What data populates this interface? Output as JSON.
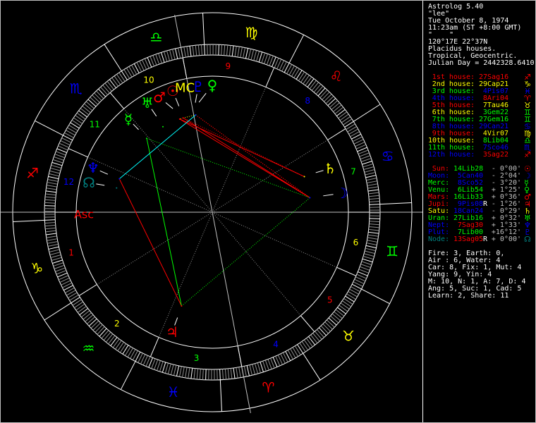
{
  "header": {
    "app_title": "Astrolog 5.40",
    "chart_name": "\"lee\"",
    "date": "Tue October 8, 1974",
    "time": "11:23am (ST +8:00 GMT)",
    "location_name": "\"    \"",
    "coordinates": "120°17E 22°37N",
    "house_system": "Placidus houses.",
    "zodiac": "Tropical, Geocentric.",
    "julian_day": "Julian Day = 2442328.6410"
  },
  "colors": {
    "red": "#ff0000",
    "yellow": "#ffff00",
    "green": "#00ff00",
    "blue": "#0000ff",
    "teal": "#008080",
    "gray": "#c0c0c0",
    "white": "#ffffff"
  },
  "houses": [
    {
      "label": "1st house:",
      "value": "27Sag16",
      "glyph": "♐",
      "label_color": "#ff0000",
      "value_color": "#ff0000",
      "lon": 267.27
    },
    {
      "label": "2nd house:",
      "value": "29Cap21",
      "glyph": "♑",
      "label_color": "#ffff00",
      "value_color": "#ffff00",
      "lon": 299.35
    },
    {
      "label": "3rd house:",
      "value": "4Pis07",
      "glyph": "♓",
      "label_color": "#00ff00",
      "value_color": "#0000ff",
      "lon": 334.12
    },
    {
      "label": "4th house:",
      "value": "8Ari04",
      "glyph": "♈",
      "label_color": "#0000ff",
      "value_color": "#ff0000",
      "lon": 8.07
    },
    {
      "label": "5th house:",
      "value": "7Tau46",
      "glyph": "♉",
      "label_color": "#ff0000",
      "value_color": "#ffff00",
      "lon": 37.77
    },
    {
      "label": "6th house:",
      "value": "3Gem22",
      "glyph": "♊",
      "label_color": "#ffff00",
      "value_color": "#00ff00",
      "lon": 63.37
    },
    {
      "label": "7th house:",
      "value": "27Gem16",
      "glyph": "♊",
      "label_color": "#00ff00",
      "value_color": "#00ff00",
      "lon": 87.27
    },
    {
      "label": "8th house:",
      "value": "29Can21",
      "glyph": "♋",
      "label_color": "#0000ff",
      "value_color": "#0000ff",
      "lon": 119.35
    },
    {
      "label": "9th house:",
      "value": "4Vir07",
      "glyph": "♍",
      "label_color": "#ff0000",
      "value_color": "#ffff00",
      "lon": 154.12
    },
    {
      "label": "10th house:",
      "value": "8Lib04",
      "glyph": "♎",
      "label_color": "#ffff00",
      "value_color": "#00ff00",
      "lon": 188.07
    },
    {
      "label": "11th house:",
      "value": "7Sco46",
      "glyph": "♏",
      "label_color": "#00ff00",
      "value_color": "#0000ff",
      "lon": 217.77
    },
    {
      "label": "12th house:",
      "value": "3Sag22",
      "glyph": "♐",
      "label_color": "#0000ff",
      "value_color": "#ff0000",
      "lon": 243.37
    }
  ],
  "planets": [
    {
      "key": "sun",
      "label": "Sun:",
      "value": "14Lib28",
      "retro": "",
      "lat": "- 0°00'",
      "glyph": "☉",
      "color": "#ff0000",
      "value_color": "#00ff00",
      "lon": 194.47
    },
    {
      "key": "moon",
      "label": "Moon:",
      "value": "5Can40",
      "retro": "",
      "lat": "- 2°04'",
      "glyph": "☽",
      "color": "#0000ff",
      "value_color": "#0000ff",
      "lon": 95.67
    },
    {
      "key": "merc",
      "label": "Merc:",
      "value": "8Sco52",
      "retro": "",
      "lat": "- 3°20'",
      "glyph": "☿",
      "color": "#00ff00",
      "value_color": "#0000ff",
      "lon": 218.87
    },
    {
      "key": "venu",
      "label": "Venu:",
      "value": "6Lib54",
      "retro": "",
      "lat": "+ 1°25'",
      "glyph": "♀",
      "color": "#00ff00",
      "value_color": "#00ff00",
      "lon": 186.9
    },
    {
      "key": "mars",
      "label": "Mars:",
      "value": "16Lib33",
      "retro": "",
      "lat": "+ 0°36'",
      "glyph": "♂",
      "color": "#ff0000",
      "value_color": "#00ff00",
      "lon": 196.55
    },
    {
      "key": "jupi",
      "label": "Jupi:",
      "value": "9Pis08",
      "retro": "R",
      "lat": "- 1°26'",
      "glyph": "♃",
      "color": "#ff0000",
      "value_color": "#0000ff",
      "lon": 339.13
    },
    {
      "key": "satu",
      "label": "Satu:",
      "value": "18Can24",
      "retro": "",
      "lat": "- 0°29'",
      "glyph": "♄",
      "color": "#ffff00",
      "value_color": "#0000ff",
      "lon": 108.4
    },
    {
      "key": "uran",
      "label": "Uran:",
      "value": "27Lib16",
      "retro": "",
      "lat": "+ 0°32'",
      "glyph": "♅",
      "color": "#00ff00",
      "value_color": "#00ff00",
      "lon": 207.27
    },
    {
      "key": "nept",
      "label": "Nept:",
      "value": "7Sag30",
      "retro": "",
      "lat": "+ 1°33'",
      "glyph": "♆",
      "color": "#0000ff",
      "value_color": "#ff0000",
      "lon": 247.5
    },
    {
      "key": "plut",
      "label": "Plut:",
      "value": "7Lib00",
      "retro": "",
      "lat": "+16°12'",
      "glyph": "♇",
      "color": "#0000ff",
      "value_color": "#00ff00",
      "lon": 187.0
    },
    {
      "key": "node",
      "label": "Node:",
      "value": "13Sag05",
      "retro": "R",
      "lat": "+ 0°00'",
      "glyph": "☊",
      "color": "#008080",
      "value_color": "#ff0000",
      "lon": 253.08
    }
  ],
  "stats": [
    "Fire: 3, Earth: 0,",
    "Air : 6, Water: 4",
    "Car: 8, Fix: 1, Mut: 4",
    "Yang: 9, Yin: 4",
    "M: 10, N: 1, A: 7, D: 4",
    "Ang: 5, Suc: 1, Cad: 5",
    "Learn: 2, Share: 11"
  ],
  "wheel": {
    "asc_label": "Asc",
    "mc_label": "MC",
    "asc_color": "#ff0000",
    "mc_color": "#ffff00",
    "house_numbers": [
      "1",
      "2",
      "3",
      "4",
      "5",
      "6",
      "7",
      "8",
      "9",
      "10",
      "11",
      "12"
    ],
    "signs": [
      {
        "glyph": "♈",
        "color": "#ff0000"
      },
      {
        "glyph": "♉",
        "color": "#ffff00"
      },
      {
        "glyph": "♊",
        "color": "#00ff00"
      },
      {
        "glyph": "♋",
        "color": "#0000ff"
      },
      {
        "glyph": "♌",
        "color": "#ff0000"
      },
      {
        "glyph": "♍",
        "color": "#ffff00"
      },
      {
        "glyph": "♎",
        "color": "#00ff00"
      },
      {
        "glyph": "♏",
        "color": "#0000ff"
      },
      {
        "glyph": "♐",
        "color": "#ff0000"
      },
      {
        "glyph": "♑",
        "color": "#ffff00"
      },
      {
        "glyph": "♒",
        "color": "#00ff00"
      },
      {
        "glyph": "♓",
        "color": "#0000ff"
      }
    ],
    "aspects": [
      {
        "a": "sun",
        "b": "moon",
        "type": "square",
        "color": "#ff0000",
        "dotted": false
      },
      {
        "a": "mars",
        "b": "moon",
        "type": "square",
        "color": "#ff0000",
        "dotted": false
      },
      {
        "a": "venu",
        "b": "moon",
        "type": "square",
        "color": "#ff0000",
        "dotted": true
      },
      {
        "a": "plut",
        "b": "moon",
        "type": "square",
        "color": "#ff0000",
        "dotted": true
      },
      {
        "a": "sun",
        "b": "satu",
        "type": "square",
        "color": "#ff0000",
        "dotted": true
      },
      {
        "a": "mars",
        "b": "satu",
        "type": "square",
        "color": "#ff0000",
        "dotted": false
      },
      {
        "a": "nept",
        "b": "jupi",
        "type": "square",
        "color": "#ff0000",
        "dotted": false
      },
      {
        "a": "merc",
        "b": "jupi",
        "type": "trine",
        "color": "#00ff00",
        "dotted": false
      },
      {
        "a": "merc",
        "b": "moon",
        "type": "trine",
        "color": "#00ff00",
        "dotted": true
      },
      {
        "a": "jupi",
        "b": "moon",
        "type": "trine",
        "color": "#00ff00",
        "dotted": true
      },
      {
        "a": "nept",
        "b": "venu",
        "type": "sextile",
        "color": "#00ffff",
        "dotted": false
      },
      {
        "a": "sun",
        "b": "mars",
        "type": "conjunction",
        "color": "#ffff00",
        "dotted": true
      },
      {
        "a": "venu",
        "b": "sun",
        "type": "conjunction",
        "color": "#ffff00",
        "dotted": true
      }
    ]
  }
}
